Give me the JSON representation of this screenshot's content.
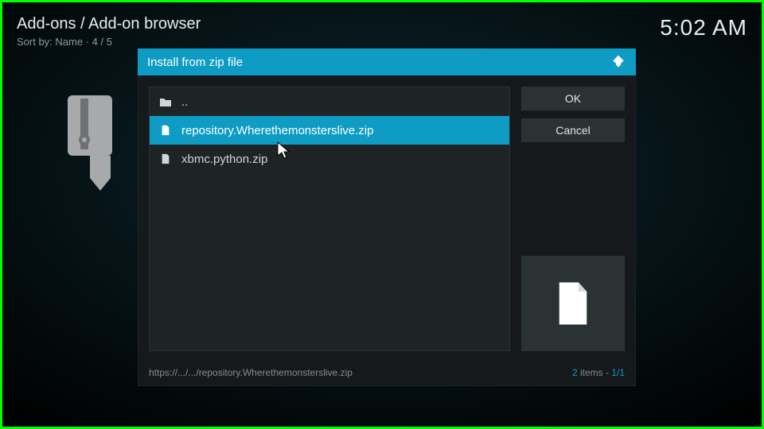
{
  "header": {
    "breadcrumb": "Add-ons / Add-on browser",
    "sort_label": "Sort by: Name  ·  4 / 5",
    "clock": "5:02 AM"
  },
  "dialog": {
    "title": "Install from zip file",
    "ok_label": "OK",
    "cancel_label": "Cancel",
    "items": {
      "up": "..",
      "file1": "repository.Wherethemonsterslive.zip",
      "file2": "xbmc.python.zip"
    },
    "footer_path": "https://.../.../repository.Wherethemonsterslive.zip",
    "footer_count_num": "2",
    "footer_count_word": " items - ",
    "footer_page": "1/1"
  }
}
